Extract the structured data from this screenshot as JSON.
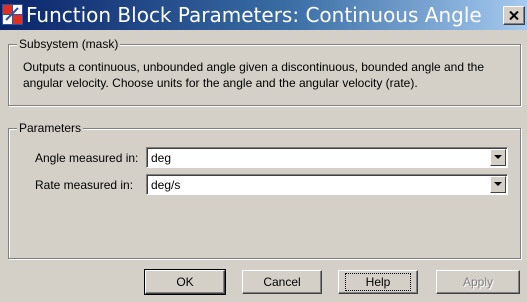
{
  "window": {
    "title": "Function Block Parameters: Continuous Angle",
    "close_label": "✕"
  },
  "subsystem": {
    "legend": "Subsystem (mask)",
    "description": "Outputs a continuous, unbounded angle given a discontinuous, bounded angle and the angular velocity. Choose units for the angle and the angular velocity (rate)."
  },
  "parameters": {
    "legend": "Parameters",
    "angle": {
      "label": "Angle measured in:",
      "value": "deg"
    },
    "rate": {
      "label": "Rate measured in:",
      "value": "deg/s"
    }
  },
  "buttons": {
    "ok": "OK",
    "cancel": "Cancel",
    "help": "Help",
    "apply": "Apply"
  }
}
